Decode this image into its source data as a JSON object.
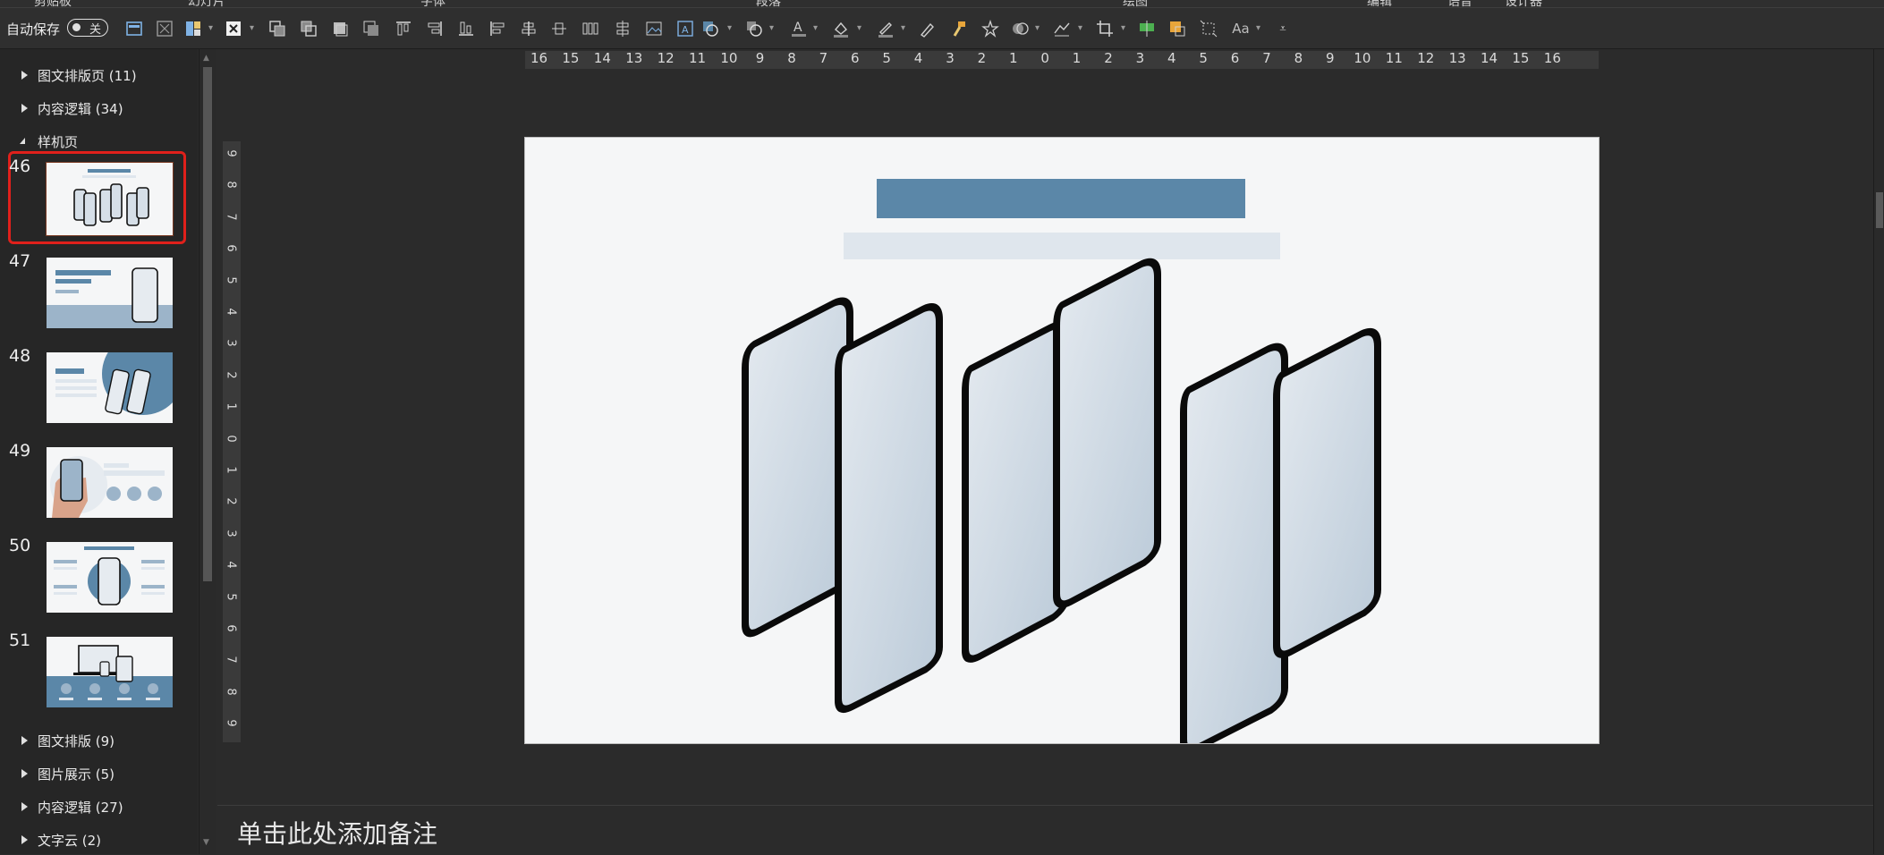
{
  "ribbon": {
    "group_labels": [
      "剪贴板",
      "幻灯片",
      "字体",
      "段落",
      "绘图",
      "编辑",
      "语音",
      "设计器"
    ]
  },
  "toolbar": {
    "autosave_label": "自动保存",
    "autosave_state": "关",
    "icons": [
      "section-icon",
      "clear-format-icon",
      "layout-icon",
      "delete-slide-icon",
      "bring-forward-icon",
      "send-backward-icon",
      "bring-to-front-icon",
      "send-to-back-icon",
      "align-top-icon",
      "align-right-icon",
      "align-bottom-icon",
      "align-left-icon",
      "align-center-icon",
      "distribute-h-icon",
      "distribute-v-icon",
      "picture-icon",
      "textbox-icon",
      "shapes-icon",
      "arrange-icon",
      "font-color-icon",
      "fill-color-icon",
      "outline-color-icon",
      "format-painter-icon",
      "brush-icon",
      "effects-icon",
      "merge-shapes-icon",
      "edit-shape-icon",
      "crop-icon",
      "resize-icon",
      "replace-icon",
      "size-icon",
      "change-case-icon",
      "more-icon"
    ],
    "change_case_label": "Aa"
  },
  "sidebar": {
    "sections": [
      {
        "label": "图文排版页 (11)",
        "expanded": false
      },
      {
        "label": "内容逻辑 (34)",
        "expanded": false
      },
      {
        "label": "样机页",
        "expanded": true
      }
    ],
    "slides": [
      {
        "number": "46",
        "selected": true
      },
      {
        "number": "47",
        "selected": false
      },
      {
        "number": "48",
        "selected": false
      },
      {
        "number": "49",
        "selected": false
      },
      {
        "number": "50",
        "selected": false
      },
      {
        "number": "51",
        "selected": false
      }
    ],
    "sections_after": [
      {
        "label": "图文排版 (9)",
        "expanded": false
      },
      {
        "label": "图片展示 (5)",
        "expanded": false
      },
      {
        "label": "内容逻辑 (27)",
        "expanded": false
      },
      {
        "label": "文字云 (2)",
        "expanded": false
      }
    ]
  },
  "ruler": {
    "horizontal": [
      "16",
      "15",
      "14",
      "13",
      "12",
      "11",
      "10",
      "9",
      "8",
      "7",
      "6",
      "5",
      "4",
      "3",
      "2",
      "1",
      "0",
      "1",
      "2",
      "3",
      "4",
      "5",
      "6",
      "7",
      "8",
      "9",
      "10",
      "11",
      "12",
      "13",
      "14",
      "15",
      "16"
    ],
    "vertical": [
      "9",
      "8",
      "7",
      "6",
      "5",
      "4",
      "3",
      "2",
      "1",
      "0",
      "1",
      "2",
      "3",
      "4",
      "5",
      "6",
      "7",
      "8",
      "9"
    ]
  },
  "slide": {
    "title_color": "#5b87a8",
    "subtitle_color": "#dfe6ed",
    "background": "#f5f6f7"
  },
  "notes": {
    "placeholder": "单击此处添加备注"
  },
  "colors": {
    "accent": "#5b87a8",
    "selection": "#e0201b",
    "chrome": "#2b2b2b"
  }
}
